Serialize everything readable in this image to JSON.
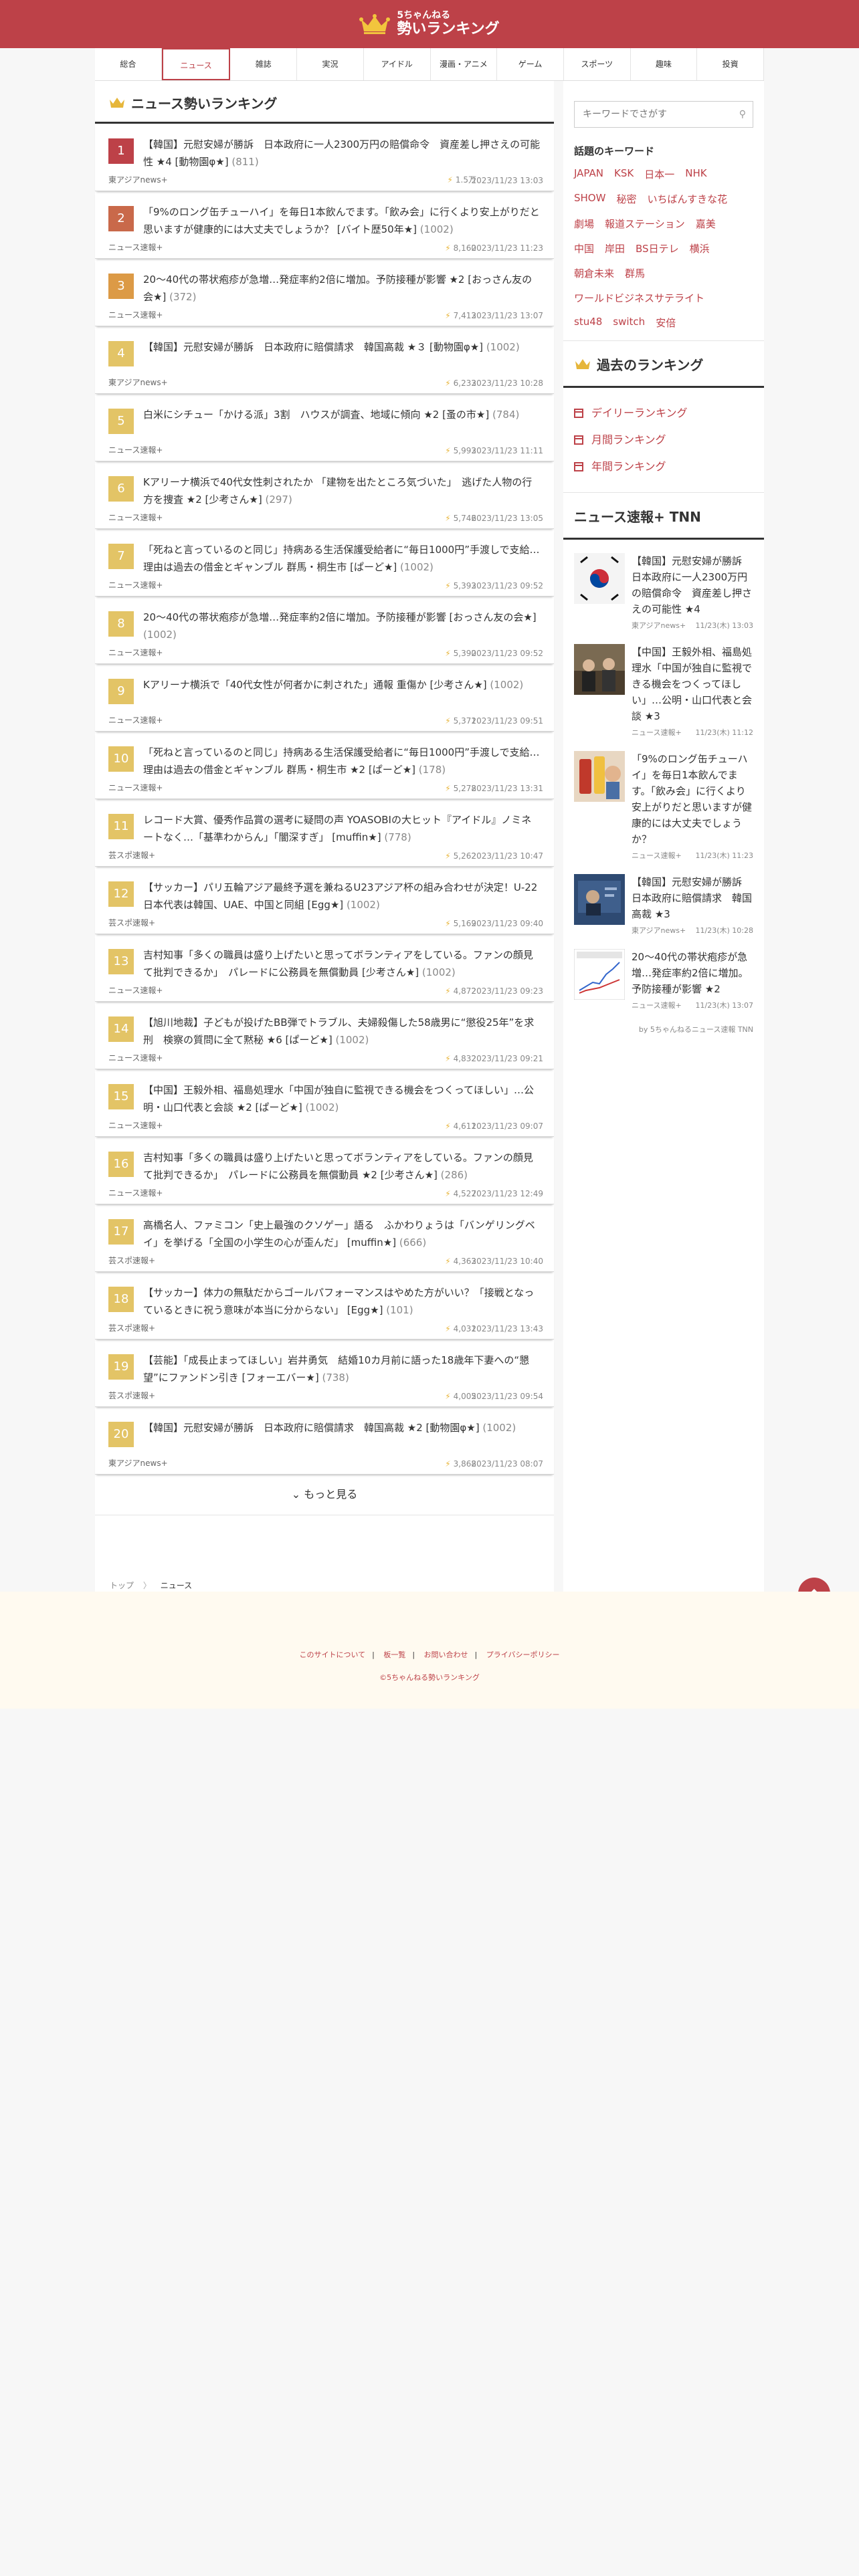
{
  "header": {
    "logo_small": "5ちゃんねる",
    "logo_main": "勢いランキング"
  },
  "nav": [
    "総合",
    "ニュース",
    "雑誌",
    "実況",
    "アイドル",
    "漫画・アニメ",
    "ゲーム",
    "スポーツ",
    "趣味",
    "投資"
  ],
  "main": {
    "title": "ニュース勢いランキング",
    "items": [
      {
        "rank": "1",
        "color": "#bd4148",
        "title": "【韓国】元慰安婦が勝訴　日本政府に一人2300万円の賠償命令　資産差し押さえの可能性 ★4 [動物園φ★]",
        "count": "(811)",
        "source": "東アジアnews+",
        "views": "1.5万",
        "date": "2023/11/23 13:03"
      },
      {
        "rank": "2",
        "color": "#c9694a",
        "title": "「9%のロング缶チューハイ」を毎日1本飲んでます。「飲み会」に行くより安上がりだと思いますが健康的には大丈夫でしょうか？ [バイト歴50年★]",
        "count": "(1002)",
        "source": "ニュース速報+",
        "views": "8,160",
        "date": "2023/11/23 11:23"
      },
      {
        "rank": "3",
        "color": "#dc9a46",
        "title": "20〜40代の帯状疱疹が急増…発症率約2倍に増加。予防接種が影響 ★2 [おっさん友の会★]",
        "count": "(372)",
        "source": "ニュース速報+",
        "views": "7,413",
        "date": "2023/11/23 13:07"
      },
      {
        "rank": "4",
        "color": "#e3c466",
        "title": "【韓国】元慰安婦が勝訴　日本政府に賠償請求　韓国高裁 ★３ [動物園φ★]",
        "count": "(1002)",
        "source": "東アジアnews+",
        "views": "6,233",
        "date": "2023/11/23 10:28"
      },
      {
        "rank": "5",
        "color": "#e3c466",
        "title": "白米にシチュー「かける派」3割　ハウスが調査、地域に傾向 ★2 [蚤の市★]",
        "count": "(784)",
        "source": "ニュース速報+",
        "views": "5,993",
        "date": "2023/11/23 11:11"
      },
      {
        "rank": "6",
        "color": "#e3c466",
        "title": "Kアリーナ横浜で40代女性刺されたか 「建物を出たところ気づいた」　逃げた人物の行方を捜査 ★2 [少考さん★]",
        "count": "(297)",
        "source": "ニュース速報+",
        "views": "5,746",
        "date": "2023/11/23 13:05"
      },
      {
        "rank": "7",
        "color": "#e3c466",
        "title": "「死ねと言っているのと同じ」持病ある生活保護受給者に“毎日1000円”手渡しで支給…理由は過去の借金とギャンブル 群馬・桐生市 [ぱーど★]",
        "count": "(1002)",
        "source": "ニュース速報+",
        "views": "5,393",
        "date": "2023/11/23 09:52"
      },
      {
        "rank": "8",
        "color": "#e3c466",
        "title": "20〜40代の帯状疱疹が急増…発症率約2倍に増加。予防接種が影響 [おっさん友の会★]",
        "count": "(1002)",
        "source": "ニュース速報+",
        "views": "5,390",
        "date": "2023/11/23 09:52"
      },
      {
        "rank": "9",
        "color": "#e3c466",
        "title": "Kアリーナ横浜で「40代女性が何者かに刺された」通報 重傷か [少考さん★]",
        "count": "(1002)",
        "source": "ニュース速報+",
        "views": "5,371",
        "date": "2023/11/23 09:51"
      },
      {
        "rank": "10",
        "color": "#e3c466",
        "title": "「死ねと言っているのと同じ」持病ある生活保護受給者に“毎日1000円”手渡しで支給…理由は過去の借金とギャンブル 群馬・桐生市 ★2 [ぱーど★]",
        "count": "(178)",
        "source": "ニュース速報+",
        "views": "5,278",
        "date": "2023/11/23 13:31"
      },
      {
        "rank": "11",
        "color": "#e3c466",
        "title": "レコード大賞、優秀作品賞の選考に疑問の声 YOASOBIの大ヒット『アイドル』ノミネートなく…「基準わからん」「闇深すぎ」 [muffin★]",
        "count": "(778)",
        "source": "芸スポ速報+",
        "views": "5,262",
        "date": "2023/11/23 10:47"
      },
      {
        "rank": "12",
        "color": "#e3c466",
        "title": "【サッカー】パリ五輪アジア最終予選を兼ねるU23アジア杯の組み合わせが決定！U-22日本代表は韓国、UAE、中国と同組 [Egg★]",
        "count": "(1002)",
        "source": "芸スポ速報+",
        "views": "5,169",
        "date": "2023/11/23 09:40"
      },
      {
        "rank": "13",
        "color": "#e3c466",
        "title": "吉村知事「多くの職員は盛り上げたいと思ってボランティアをしている。ファンの顔見て批判できるか」　パレードに公務員を無償動員 [少考さん★]",
        "count": "(1002)",
        "source": "ニュース速報+",
        "views": "4,872",
        "date": "2023/11/23 09:23"
      },
      {
        "rank": "14",
        "color": "#e3c466",
        "title": "【旭川地裁】子どもが投げたBB弾でトラブル、夫婦殺傷した58歳男に“懲役25年”を求刑　検察の質問に全て黙秘 ★6 [ぱーど★]",
        "count": "(1002)",
        "source": "ニュース速報+",
        "views": "4,832",
        "date": "2023/11/23 09:21"
      },
      {
        "rank": "15",
        "color": "#e3c466",
        "title": "【中国】王毅外相、福島処理水「中国が独自に監視できる機会をつくってほしい」…公明・山口代表と会談 ★2 [ぱーど★]",
        "count": "(1002)",
        "source": "ニュース速報+",
        "views": "4,611",
        "date": "2023/11/23 09:07"
      },
      {
        "rank": "16",
        "color": "#e3c466",
        "title": "吉村知事「多くの職員は盛り上げたいと思ってボランティアをしている。ファンの顔見て批判できるか」　パレードに公務員を無償動員 ★2 [少考さん★]",
        "count": "(286)",
        "source": "ニュース速報+",
        "views": "4,527",
        "date": "2023/11/23 12:49"
      },
      {
        "rank": "17",
        "color": "#e3c466",
        "title": "高橋名人、ファミコン「史上最強のクソゲー」語る　ふかわりょうは「バンゲリングベイ」を挙げる「全国の小学生の心が歪んだ」 [muffin★]",
        "count": "(666)",
        "source": "芸スポ速報+",
        "views": "4,363",
        "date": "2023/11/23 10:40"
      },
      {
        "rank": "18",
        "color": "#e3c466",
        "title": "【サッカー】体力の無駄だからゴールパフォーマンスはやめた方がいい？「接戦となっているときに祝う意味が本当に分からない」 [Egg★]",
        "count": "(101)",
        "source": "芸スポ速報+",
        "views": "4,031",
        "date": "2023/11/23 13:43"
      },
      {
        "rank": "19",
        "color": "#e3c466",
        "title": "【芸能】「成長止まってほしい」岩井勇気　結婚10カ月前に語った18歳年下妻への“懇望”にファンドン引き [フォーエバー★]",
        "count": "(738)",
        "source": "芸スポ速報+",
        "views": "4,005",
        "date": "2023/11/23 09:54"
      },
      {
        "rank": "20",
        "color": "#e3c466",
        "title": "【韓国】元慰安婦が勝訴　日本政府に賠償請求　韓国高裁 ★2 [動物園φ★]",
        "count": "(1002)",
        "source": "東アジアnews+",
        "views": "3,868",
        "date": "2023/11/23 08:07"
      }
    ],
    "more_label": "もっと見る"
  },
  "breadcrumb": {
    "home": "トップ",
    "sep": "〉",
    "current": "ニュース"
  },
  "side": {
    "search_placeholder": "キーワードでさがす",
    "kw_title": "話題のキーワード",
    "keywords": [
      "JAPAN",
      "KSK",
      "日本一",
      "NHK",
      "SHOW",
      "秘密",
      "いちばんすきな花",
      "劇場",
      "報道ステーション",
      "嘉美",
      "中国",
      "岸田",
      "BS日テレ",
      "横浜",
      "朝倉未来",
      "群馬",
      "ワールドビジネスサテライト",
      "stu48",
      "switch",
      "安倍"
    ],
    "hist_title": "過去のランキング",
    "hist": [
      "デイリーランキング",
      "月間ランキング",
      "年間ランキング"
    ],
    "tnn_title": "ニュース速報+ TNN",
    "tnn": [
      {
        "text": "【韓国】元慰安婦が勝訴　日本政府に一人2300万円の賠償命令　資産差し押さえの可能性 ★4",
        "src": "東アジアnews+",
        "date": "11/23(木) 13:03"
      },
      {
        "text": "【中国】王毅外相、福島処理水「中国が独自に監視できる機会をつくってほしい」…公明・山口代表と会談 ★3",
        "src": "ニュース速報+",
        "date": "11/23(木) 11:12"
      },
      {
        "text": "「9%のロング缶チューハイ」を毎日1本飲んでます。「飲み会」に行くより安上がりだと思いますが健康的には大丈夫でしょうか？",
        "src": "ニュース速報+",
        "date": "11/23(木) 11:23"
      },
      {
        "text": "【韓国】元慰安婦が勝訴　日本政府に賠償請求　韓国高裁 ★3",
        "src": "東アジアnews+",
        "date": "11/23(木) 10:28"
      },
      {
        "text": "20〜40代の帯状疱疹が急増…発症率約2倍に増加。予防接種が影響 ★2",
        "src": "ニュース速報+",
        "date": "11/23(木) 13:07"
      }
    ],
    "by": "by 5ちゃんねるニュース速報 TNN"
  },
  "footer": {
    "links": [
      "このサイトについて",
      "板一覧",
      "お問い合わせ",
      "プライバシーポリシー"
    ],
    "copy": "©5ちゃんねる勢いランキング"
  }
}
